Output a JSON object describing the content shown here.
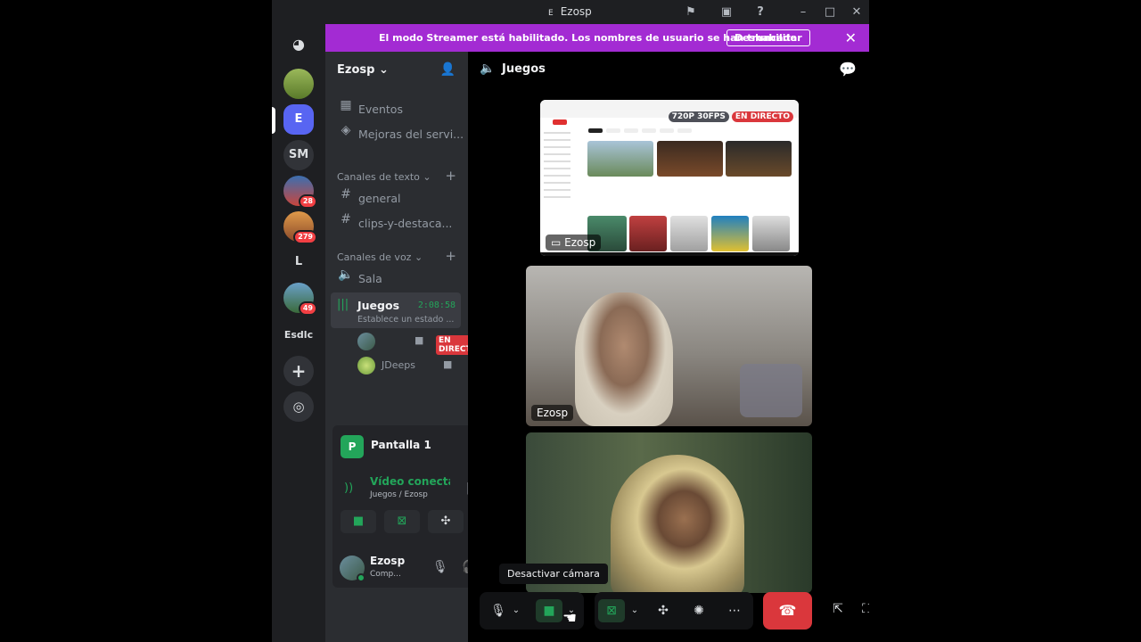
{
  "window": {
    "title_glyph": "E",
    "title": "Ezosp"
  },
  "banner": {
    "text": "El modo Streamer está habilitado. Los nombres de usuario se han truncado.",
    "button": "Deshabilitar"
  },
  "rail": {
    "servers": [
      {
        "label": "E"
      },
      {
        "label": "SM"
      },
      {
        "badge": "28"
      },
      {
        "badge": "279"
      },
      {
        "label": "L"
      },
      {
        "badge": "49"
      },
      {
        "label": "Esdlc"
      }
    ]
  },
  "guild": {
    "name": "Ezosp",
    "items": [
      {
        "label": "Eventos"
      },
      {
        "label": "Mejoras del servi..."
      }
    ],
    "text_category": "Canales de texto",
    "text_channels": [
      "general",
      "clips-y-destaca..."
    ],
    "voice_category": "Canales de voz",
    "voice_channels": [
      "Sala"
    ],
    "active_voice": {
      "name": "Juegos",
      "timer": "2:08:58",
      "status": "Establece un estado ..."
    },
    "voice_users": [
      {
        "name": "",
        "live": "EN DIRECTO"
      },
      {
        "name": "JDeeps"
      }
    ]
  },
  "share": {
    "screen_initial": "P",
    "screen_label": "Pantalla 1",
    "conn_title": "Vídeo conectado",
    "conn_sub": "Juegos / Ezosp"
  },
  "user": {
    "name": "Ezosp",
    "status": "Comp..."
  },
  "stage": {
    "channel": "Juegos",
    "tiles": [
      {
        "name": "Ezosp",
        "quality": "720P 30FPS",
        "live": "EN DIRECTO"
      },
      {
        "name": "Ezosp"
      },
      {
        "name": ""
      }
    ],
    "tooltip": "Desactivar cámara"
  },
  "colors": {
    "banner": "#a32bd3",
    "accent_green": "#23a55a",
    "danger": "#da373c",
    "blurple": "#5865f2"
  },
  "icons": [
    "discord-icon",
    "flag-icon",
    "screen-icon",
    "help-icon",
    "calendar-icon",
    "boost-icon",
    "hash-icon",
    "speaker-icon",
    "camera-icon",
    "mic-icon",
    "headphones-icon",
    "gear-icon",
    "hangup-icon",
    "chat-icon",
    "popout-icon",
    "fullscreen-icon"
  ]
}
